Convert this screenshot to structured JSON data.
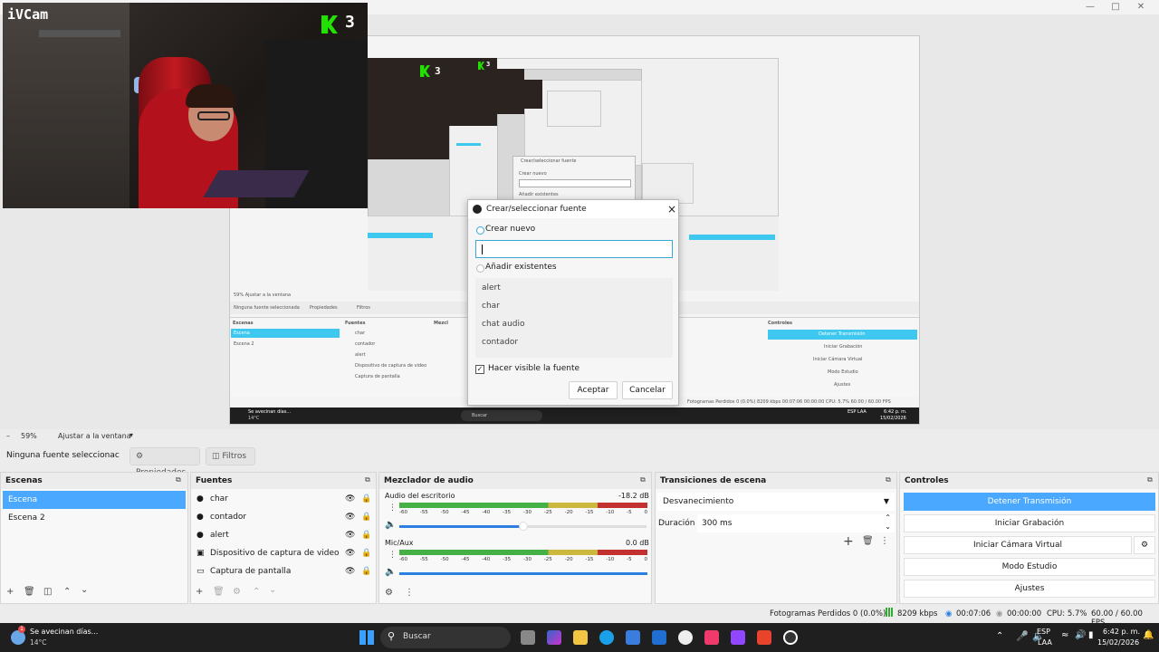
{
  "cam": {
    "title": "iVCam",
    "score": "3",
    "nested_score_1": "3",
    "nested_score_2": "3"
  },
  "nested_preview": {
    "small_dialog_title": "Crear/seleccionar fuente",
    "small_create": "Crear nuevo",
    "small_add": "Añadir existentes",
    "zoom_text": "59%   Ajustar a la ventana",
    "no_source": "Ninguna fuente seleccionada",
    "props": "Propiedades",
    "filters": "Filtros",
    "scenes_h": "Escenas",
    "sources_h": "Fuentes",
    "mixer_h": "Mezcl",
    "controls_h": "Controles",
    "scenes": [
      "Escena",
      "Escena 2"
    ],
    "sources": [
      "char",
      "contador",
      "alert",
      "Dispositivo de captura de video",
      "Captura de pantalla"
    ],
    "controls": [
      "Detener Transmisión",
      "Iniciar Grabación",
      "Iniciar Cámara Virtual",
      "Modo Estudio",
      "Ajustes"
    ],
    "status": "Fotogramas Perdidos 0 (0.0%)   8209 kbps   00:07:06   00:00:00   CPU: 5.7%   60.00 / 60.00 FPS",
    "task_weather": "Se avecinan días...",
    "task_temp": "14°C",
    "task_search": "Buscar",
    "task_lang": "ESP LAA",
    "task_time": "6:42 p. m.",
    "task_date": "15/02/2026"
  },
  "dialog": {
    "title": "Crear/seleccionar fuente",
    "create_new": "Crear nuevo",
    "name_value": "",
    "add_existing": "Añadir existentes",
    "existing": [
      "alert",
      "char",
      "chat audio",
      "contador"
    ],
    "make_visible": "Hacer visible la fuente",
    "make_visible_checked": true,
    "ok": "Aceptar",
    "cancel": "Cancelar"
  },
  "zoombar": {
    "zoom": "59%",
    "fit": "Ajustar a la ventana"
  },
  "source_toolbar": {
    "none_selected": "Ninguna fuente seleccionac",
    "properties": "Propiedades",
    "filters": "Filtros"
  },
  "scenes": {
    "header": "Escenas",
    "items": [
      "Escena",
      "Escena 2"
    ],
    "selected": 0
  },
  "sources": {
    "header": "Fuentes",
    "items": [
      {
        "label": "char",
        "icon": "globe-icon"
      },
      {
        "label": "contador",
        "icon": "globe-icon"
      },
      {
        "label": "alert",
        "icon": "globe-icon"
      },
      {
        "label": "Dispositivo de captura de video",
        "icon": "camera-icon"
      },
      {
        "label": "Captura de pantalla",
        "icon": "monitor-icon"
      }
    ]
  },
  "mixer": {
    "header": "Mezclador de audio",
    "tracks": [
      {
        "name": "Audio del escritorio",
        "level": "-18.2 dB",
        "volume": 0.95
      },
      {
        "name": "Mic/Aux",
        "level": "0.0 dB",
        "volume": 1.0
      }
    ],
    "scale": [
      "-60",
      "-55",
      "-50",
      "-45",
      "-40",
      "-35",
      "-30",
      "-25",
      "-20",
      "-15",
      "-10",
      "-5",
      "0"
    ]
  },
  "transitions": {
    "header": "Transiciones de escena",
    "selected": "Desvanecimiento",
    "duration_label": "Duración",
    "duration_value": "300 ms"
  },
  "controls": {
    "header": "Controles",
    "stop_stream": "Detener Transmisión",
    "start_record": "Iniciar Grabación",
    "start_vcam": "Iniciar Cámara Virtual",
    "studio_mode": "Modo Estudio",
    "settings": "Ajustes"
  },
  "status": {
    "dropped": "Fotogramas Perdidos 0 (0.0%)",
    "bitrate": "8209 kbps",
    "stream_time": "00:07:06",
    "rec_time": "00:00:00",
    "cpu": "CPU: 5.7%",
    "fps": "60.00 / 60.00 FPS"
  },
  "taskbar": {
    "weather": "Se avecinan días...",
    "temp": "14°C",
    "badge": "1",
    "search": "Buscar",
    "lang1": "ESP",
    "lang2": "LAA",
    "time": "6:42 p. m.",
    "date": "15/02/2026"
  }
}
